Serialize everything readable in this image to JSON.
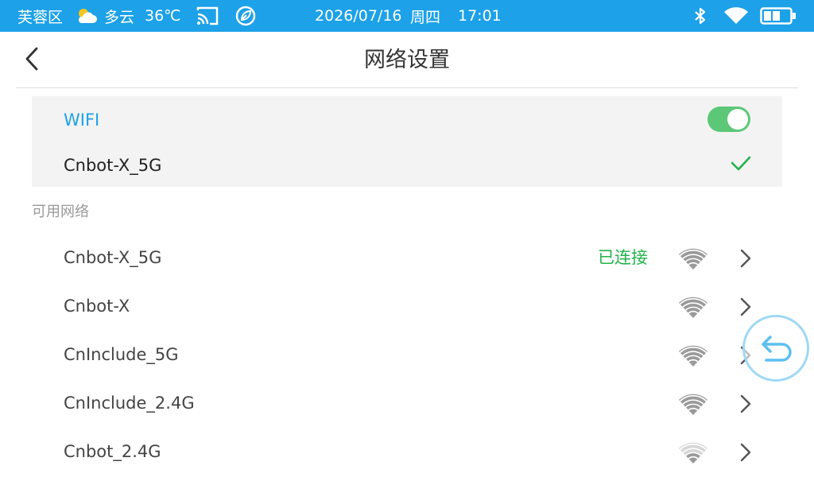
{
  "status_bar": {
    "location": "芙蓉区",
    "weather": "多云",
    "temperature": "36℃",
    "date": "2026/07/16",
    "weekday": "周四",
    "time": "17:01",
    "icons": [
      "partly-cloudy-icon",
      "cast-icon",
      "leaf-icon",
      "bluetooth-icon",
      "wifi-icon",
      "battery-icon"
    ]
  },
  "header": {
    "title": "网络设置"
  },
  "wifi": {
    "label": "WIFI",
    "enabled": true,
    "current_network": "Cnbot-X_5G"
  },
  "available": {
    "label": "可用网络",
    "networks": [
      {
        "name": "Cnbot-X_5G",
        "status": "已连接",
        "signal": "strong"
      },
      {
        "name": "Cnbot-X",
        "status": "",
        "signal": "strong"
      },
      {
        "name": "CnInclude_5G",
        "status": "",
        "signal": "strong"
      },
      {
        "name": "CnInclude_2.4G",
        "status": "",
        "signal": "strong"
      },
      {
        "name": "Cnbot_2.4G",
        "status": "",
        "signal": "weak"
      }
    ]
  },
  "colors": {
    "status_bar": "#1da1e8",
    "accent": "#1da1e8",
    "toggle_on": "#5cc877",
    "connected": "#22b34a"
  }
}
